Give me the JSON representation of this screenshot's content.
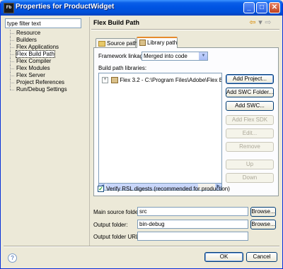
{
  "window": {
    "title": "Properties for ProductWidget",
    "app_icon": "Fb",
    "controls": {
      "minimize": "_",
      "maximize": "□",
      "close": "✕"
    }
  },
  "sidebar": {
    "filter_value": "type filter text",
    "items": [
      {
        "label": "Resource"
      },
      {
        "label": "Builders"
      },
      {
        "label": "Flex Applications"
      },
      {
        "label": "Flex Build Path",
        "selected": true
      },
      {
        "label": "Flex Compiler"
      },
      {
        "label": "Flex Modules"
      },
      {
        "label": "Flex Server"
      },
      {
        "label": "Project References"
      },
      {
        "label": "Run/Debug Settings"
      }
    ]
  },
  "page": {
    "title": "Flex Build Path",
    "nav_back": "⇦",
    "nav_forward": "⇨",
    "nav_menu": "▾"
  },
  "tabs": [
    {
      "label": "Source path",
      "icon": "source-folder-icon",
      "active": false
    },
    {
      "label": "Library path",
      "icon": "library-icon",
      "active": true
    }
  ],
  "library_path": {
    "framework_linkage_label": "Framework linkage:",
    "framework_linkage_value": "Merged into code",
    "build_path_libraries_label": "Build path libraries:",
    "libraries": [
      {
        "label": "Flex 3.2 - C:\\Program Files\\Adobe\\Flex Builder 3",
        "expander": "+"
      }
    ],
    "buttons": {
      "add_project": "Add Project...",
      "add_swc_folder": "Add SWC Folder...",
      "add_swc": "Add SWC...",
      "add_flex_sdk": "Add Flex SDK",
      "edit": "Edit...",
      "remove": "Remove",
      "up": "Up",
      "down": "Down"
    },
    "verify_rsl_label": "Verify RSL digests (recommended for production)",
    "verify_rsl_checked": true
  },
  "folders": {
    "main_source_label": "Main source folder:",
    "main_source_value": "src",
    "output_label": "Output folder:",
    "output_value": "bin-debug",
    "output_url_label": "Output folder URL:",
    "output_url_value": "",
    "browse_label": "Browse..."
  },
  "footer": {
    "help": "?",
    "ok": "OK",
    "cancel": "Cancel"
  },
  "colors": {
    "titlebar": "#0054e3",
    "dialog_bg": "#ece9d8",
    "active_tab_accent": "#e68b2c"
  }
}
